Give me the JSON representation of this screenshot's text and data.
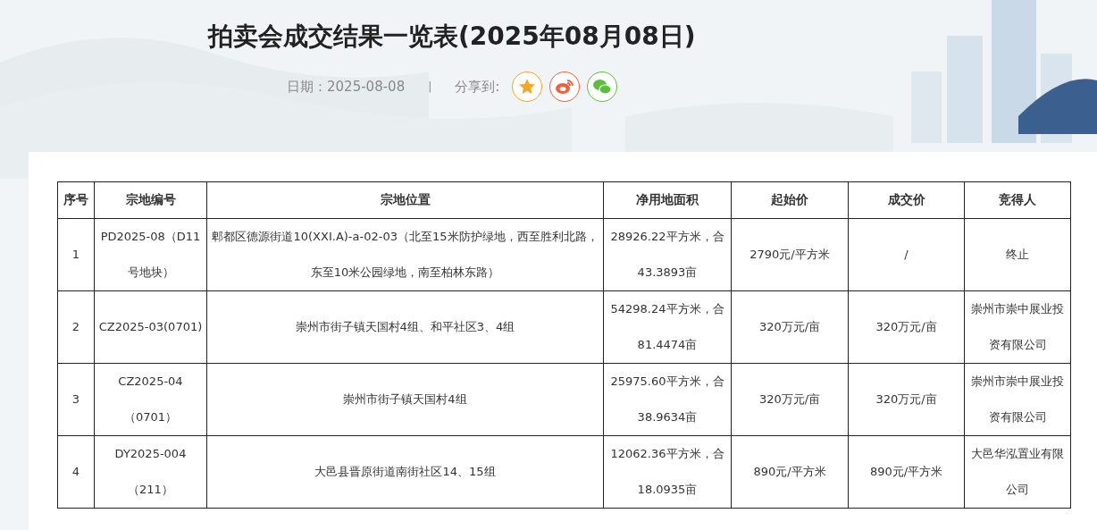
{
  "title": "拍卖会成交结果一览表(2025年08月08日)",
  "meta": {
    "date_label": "日期：",
    "date": "2025-08-08",
    "separator": "|",
    "share_label": "分享到:"
  },
  "share_buttons": [
    {
      "kind": "qzone",
      "color": "#f5a623"
    },
    {
      "kind": "weibo",
      "color": "#f0603a"
    },
    {
      "kind": "wechat",
      "color": "#5cbf3c"
    }
  ],
  "table": {
    "columns": [
      "序号",
      "宗地编号",
      "宗地位置",
      "净用地面积",
      "起始价",
      "成交价",
      "竞得人"
    ],
    "rows": [
      [
        "1",
        "PD2025-08（D11号地块）",
        "郫都区德源街道10(XXI.A)-a-02-03（北至15米防护绿地，西至胜利北路，东至10米公园绿地，南至柏林东路）",
        "28926.22平方米，合43.3893亩",
        "2790元/平方米",
        "/",
        "终止"
      ],
      [
        "2",
        "CZ2025-03(0701)",
        "崇州市街子镇天国村4组、和平社区3、4组",
        "54298.24平方米，合81.4474亩",
        "320万元/亩",
        "320万元/亩",
        "崇州市崇中展业投资有限公司"
      ],
      [
        "3",
        "CZ2025-04（0701）",
        "崇州市街子镇天国村4组",
        "25975.60平方米，合38.9634亩",
        "320万元/亩",
        "320万元/亩",
        "崇州市崇中展业投资有限公司"
      ],
      [
        "4",
        "DY2025-004（211）",
        "大邑县晋原街道南街社区14、15组",
        "12062.36平方米，合18.0935亩",
        "890元/平方米",
        "890元/平方米",
        "大邑华泓置业有限公司"
      ]
    ]
  }
}
